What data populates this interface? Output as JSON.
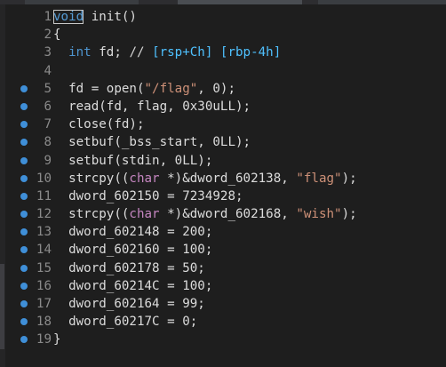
{
  "editor": {
    "lines": [
      {
        "n": "1",
        "bp": false,
        "tokens": [
          {
            "t": "void",
            "c": "kw",
            "cursor": true
          },
          {
            "t": " init()",
            "c": "fn"
          }
        ]
      },
      {
        "n": "2",
        "bp": false,
        "tokens": [
          {
            "t": "{",
            "c": "fn"
          }
        ]
      },
      {
        "n": "3",
        "bp": false,
        "tokens": [
          {
            "t": "  ",
            "c": "fn"
          },
          {
            "t": "int",
            "c": "ty"
          },
          {
            "t": " fd; ",
            "c": "fn"
          },
          {
            "t": "// ",
            "c": "cmtplain"
          },
          {
            "t": "[rsp+Ch] [rbp-4h]",
            "c": "cmt"
          }
        ]
      },
      {
        "n": "4",
        "bp": false,
        "tokens": []
      },
      {
        "n": "5",
        "bp": true,
        "tokens": [
          {
            "t": "  fd = open(",
            "c": "fn"
          },
          {
            "t": "\"/flag\"",
            "c": "str"
          },
          {
            "t": ", 0);",
            "c": "fn"
          }
        ]
      },
      {
        "n": "6",
        "bp": true,
        "tokens": [
          {
            "t": "  read(fd, flag, 0x30uLL);",
            "c": "fn"
          }
        ]
      },
      {
        "n": "7",
        "bp": true,
        "tokens": [
          {
            "t": "  close(fd);",
            "c": "fn"
          }
        ]
      },
      {
        "n": "8",
        "bp": true,
        "tokens": [
          {
            "t": "  setbuf(_bss_start, 0LL);",
            "c": "fn"
          }
        ]
      },
      {
        "n": "9",
        "bp": true,
        "tokens": [
          {
            "t": "  setbuf(stdin, 0LL);",
            "c": "fn"
          }
        ]
      },
      {
        "n": "10",
        "bp": true,
        "tokens": [
          {
            "t": "  strcpy((",
            "c": "fn"
          },
          {
            "t": "char",
            "c": "cast"
          },
          {
            "t": " *)&dword_602138, ",
            "c": "fn"
          },
          {
            "t": "\"flag\"",
            "c": "str"
          },
          {
            "t": ");",
            "c": "fn"
          }
        ]
      },
      {
        "n": "11",
        "bp": true,
        "tokens": [
          {
            "t": "  dword_602150 = 7234928;",
            "c": "fn"
          }
        ]
      },
      {
        "n": "12",
        "bp": true,
        "tokens": [
          {
            "t": "  strcpy((",
            "c": "fn"
          },
          {
            "t": "char",
            "c": "cast"
          },
          {
            "t": " *)&dword_602168, ",
            "c": "fn"
          },
          {
            "t": "\"wish\"",
            "c": "str"
          },
          {
            "t": ");",
            "c": "fn"
          }
        ]
      },
      {
        "n": "13",
        "bp": true,
        "tokens": [
          {
            "t": "  dword_602148 = 200;",
            "c": "fn"
          }
        ]
      },
      {
        "n": "14",
        "bp": true,
        "tokens": [
          {
            "t": "  dword_602160 = 100;",
            "c": "fn"
          }
        ]
      },
      {
        "n": "15",
        "bp": true,
        "tokens": [
          {
            "t": "  dword_602178 = 50;",
            "c": "fn"
          }
        ]
      },
      {
        "n": "16",
        "bp": true,
        "tokens": [
          {
            "t": "  dword_60214C = 100;",
            "c": "fn"
          }
        ]
      },
      {
        "n": "17",
        "bp": true,
        "tokens": [
          {
            "t": "  dword_602164 = 99;",
            "c": "fn"
          }
        ]
      },
      {
        "n": "18",
        "bp": true,
        "tokens": [
          {
            "t": "  dword_60217C = 0;",
            "c": "fn"
          }
        ]
      },
      {
        "n": "19",
        "bp": true,
        "tokens": [
          {
            "t": "}",
            "c": "fn"
          }
        ]
      }
    ]
  },
  "colors": {
    "background": "#1e1e1e",
    "breakpoint": "#3f8fd8",
    "keyword": "#569cd6",
    "string": "#ce9178",
    "line_number": "#8a8a8a"
  }
}
